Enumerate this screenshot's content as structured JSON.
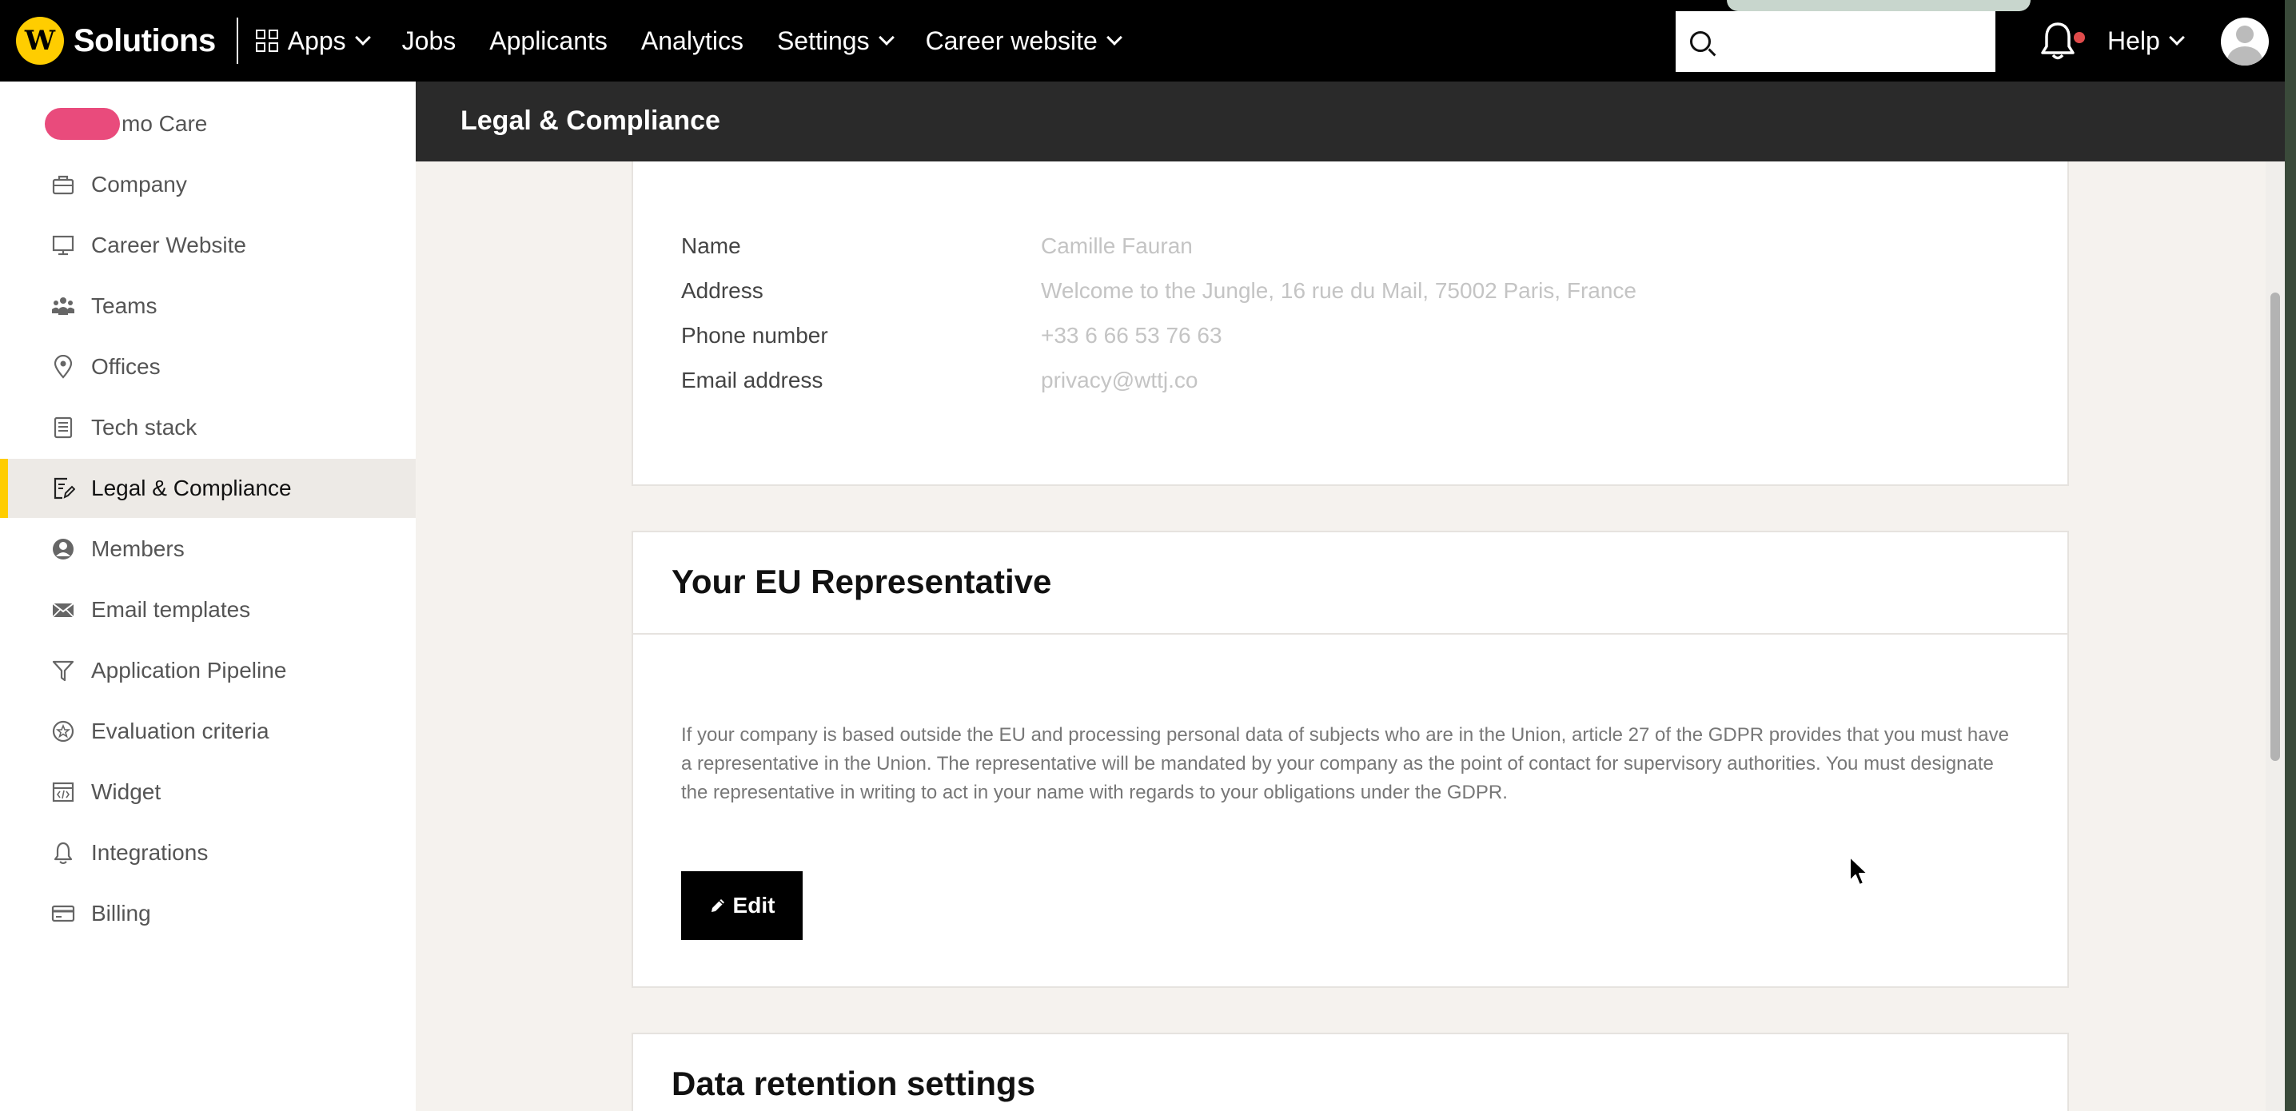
{
  "topnav": {
    "brand": "Solutions",
    "logo_letter": "W",
    "items": [
      {
        "label": "Apps",
        "dropdown": true
      },
      {
        "label": "Jobs",
        "dropdown": false
      },
      {
        "label": "Applicants",
        "dropdown": false
      },
      {
        "label": "Analytics",
        "dropdown": false
      },
      {
        "label": "Settings",
        "dropdown": true
      },
      {
        "label": "Career website",
        "dropdown": true
      }
    ],
    "search_placeholder": "",
    "help_label": "Help"
  },
  "sidebar": {
    "org_name": "mo Care",
    "items": [
      {
        "label": "Company",
        "icon": "briefcase-icon"
      },
      {
        "label": "Career Website",
        "icon": "monitor-icon"
      },
      {
        "label": "Teams",
        "icon": "team-icon"
      },
      {
        "label": "Offices",
        "icon": "location-pin-icon"
      },
      {
        "label": "Tech stack",
        "icon": "book-stack-icon"
      },
      {
        "label": "Legal & Compliance",
        "icon": "document-edit-icon",
        "active": true
      },
      {
        "label": "Members",
        "icon": "user-circle-icon"
      },
      {
        "label": "Email templates",
        "icon": "envelope-icon"
      },
      {
        "label": "Application Pipeline",
        "icon": "funnel-icon"
      },
      {
        "label": "Evaluation criteria",
        "icon": "star-badge-icon"
      },
      {
        "label": "Widget",
        "icon": "code-window-icon"
      },
      {
        "label": "Integrations",
        "icon": "plug-icon"
      },
      {
        "label": "Billing",
        "icon": "credit-card-icon"
      }
    ]
  },
  "header": {
    "title": "Legal & Compliance"
  },
  "contact_card": {
    "rows": [
      {
        "label": "Name",
        "value": "Camille Fauran"
      },
      {
        "label": "Address",
        "value": "Welcome to the Jungle, 16 rue du Mail, 75002 Paris, France"
      },
      {
        "label": "Phone number",
        "value": "+33 6 66 53 76 63"
      },
      {
        "label": "Email address",
        "value": "privacy@wttj.co"
      }
    ]
  },
  "eu_card": {
    "title": "Your EU Representative",
    "description": "If your company is based outside the EU and processing personal data of subjects who are in the Union, article 27 of the GDPR provides that you must have a representative in the Union. The representative will be mandated by your company as the point of contact for supervisory authorities. You must designate the representative in writing to act in your name with regards to your obligations under the GDPR.",
    "edit_label": "Edit"
  },
  "retention_card": {
    "title": "Data retention settings"
  },
  "colors": {
    "brand_yellow": "#ffcd00",
    "nav_bg": "#000000",
    "header_bg": "#2a2a2a",
    "page_bg": "#f5f2ee",
    "notification_dot": "#e04b4b",
    "org_badge": "#e94b7c"
  }
}
